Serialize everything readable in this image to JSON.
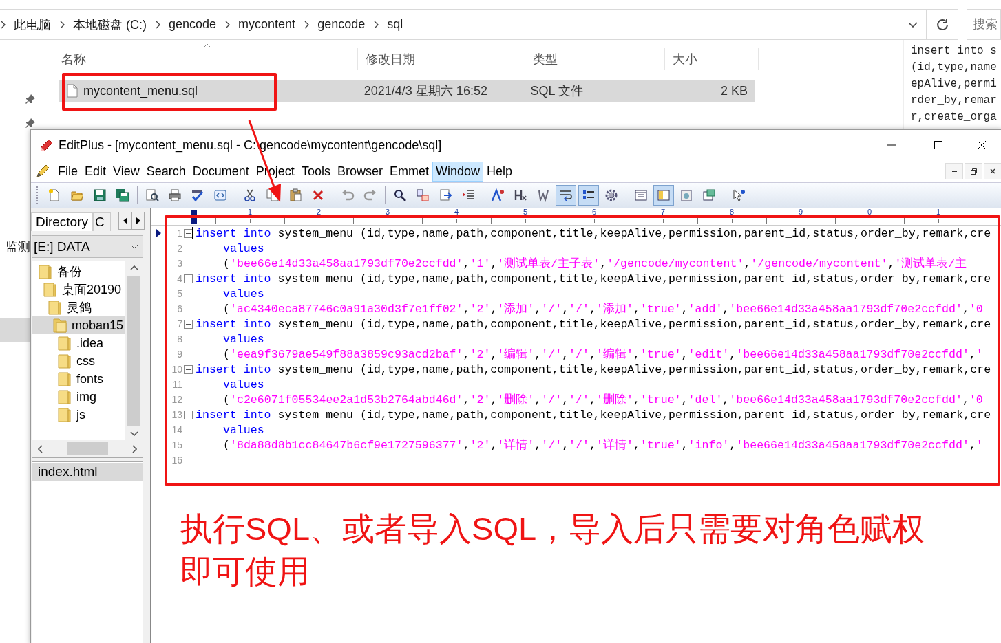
{
  "explorer": {
    "breadcrumb": [
      "此电脑",
      "本地磁盘 (C:)",
      "gencode",
      "mycontent",
      "gencode",
      "sql"
    ],
    "search": {
      "placeholder": "搜索"
    },
    "columns": [
      "名称",
      "修改日期",
      "类型",
      "大小"
    ],
    "files": [
      {
        "name": "mycontent_menu.sql",
        "modified": "2021/4/3 星期六 16:52",
        "type": "SQL 文件",
        "size": "2 KB",
        "selected": true
      }
    ],
    "preview_lines": [
      "insert into s",
      "(id,type,name",
      "epAlive,permi",
      "rder_by,remar",
      "r,create_orga"
    ],
    "nav_label": "监测"
  },
  "editplus": {
    "title": "EditPlus - [mycontent_menu.sql - C:\\gencode\\mycontent\\gencode\\sql]",
    "menu": [
      {
        "label": "File",
        "selected": false
      },
      {
        "label": "Edit",
        "selected": false
      },
      {
        "label": "View",
        "selected": false
      },
      {
        "label": "Search",
        "selected": false
      },
      {
        "label": "Document",
        "selected": false
      },
      {
        "label": "Project",
        "selected": false
      },
      {
        "label": "Tools",
        "selected": false
      },
      {
        "label": "Browser",
        "selected": false
      },
      {
        "label": "Emmet",
        "selected": false
      },
      {
        "label": "Window",
        "selected": true
      },
      {
        "label": "Help",
        "selected": false
      }
    ],
    "toolbar": [
      {
        "buttons": [
          {
            "kind": "new",
            "pressed": false
          },
          {
            "kind": "open",
            "pressed": false
          },
          {
            "kind": "save",
            "pressed": false
          },
          {
            "kind": "saveall",
            "pressed": false
          }
        ]
      },
      {
        "buttons": [
          {
            "kind": "preview",
            "pressed": false
          },
          {
            "kind": "print",
            "pressed": false
          },
          {
            "kind": "spell",
            "pressed": false
          },
          {
            "kind": "browser",
            "pressed": false
          }
        ]
      },
      {
        "buttons": [
          {
            "kind": "cut",
            "pressed": false
          },
          {
            "kind": "copy",
            "pressed": false
          },
          {
            "kind": "paste",
            "pressed": false
          },
          {
            "kind": "delete",
            "pressed": false
          }
        ]
      },
      {
        "buttons": [
          {
            "kind": "undo",
            "pressed": false
          },
          {
            "kind": "redo",
            "pressed": false
          }
        ]
      },
      {
        "buttons": [
          {
            "kind": "find",
            "pressed": false
          },
          {
            "kind": "replace",
            "pressed": false
          },
          {
            "kind": "goto",
            "pressed": false
          },
          {
            "kind": "indent",
            "pressed": false
          }
        ]
      },
      {
        "buttons": [
          {
            "kind": "font",
            "pressed": false
          },
          {
            "kind": "heading",
            "pressed": false
          },
          {
            "kind": "italic",
            "pressed": false
          },
          {
            "kind": "wrap",
            "pressed": true
          },
          {
            "kind": "linenum",
            "pressed": true
          },
          {
            "kind": "settings",
            "pressed": false
          }
        ]
      },
      {
        "buttons": [
          {
            "kind": "panel",
            "pressed": false
          },
          {
            "kind": "sidebar",
            "pressed": true
          },
          {
            "kind": "clip",
            "pressed": false
          },
          {
            "kind": "window",
            "pressed": false
          }
        ]
      },
      {
        "buttons": [
          {
            "kind": "help",
            "pressed": false
          }
        ]
      }
    ],
    "sidebar": {
      "tabs": [
        {
          "label": "Directory",
          "selected": true
        },
        {
          "label": "C",
          "selected": false
        }
      ],
      "drive": "[E:] DATA",
      "tree": [
        {
          "label": "备份",
          "selected": false,
          "children": [
            {
              "label": "桌面20190",
              "selected": false,
              "children": [
                {
                  "label": "灵鸽",
                  "selected": false,
                  "children": [
                    {
                      "label": "moban15",
                      "selected": true,
                      "children": [
                        {
                          "label": ".idea",
                          "selected": false
                        },
                        {
                          "label": "css",
                          "selected": false
                        },
                        {
                          "label": "fonts",
                          "selected": false
                        },
                        {
                          "label": "img",
                          "selected": false
                        },
                        {
                          "label": "js",
                          "selected": false
                        }
                      ]
                    }
                  ]
                }
              ]
            }
          ]
        }
      ],
      "files": [
        {
          "label": "index.html",
          "selected": true
        }
      ]
    },
    "ruler": [
      "1",
      "2",
      "3",
      "4",
      "5",
      "6",
      "7",
      "8",
      "9",
      "0",
      "1"
    ],
    "lines": [
      {
        "number": "1",
        "current": true,
        "foldable": true,
        "indented": false,
        "tokens": [
          {
            "kind": "keyword",
            "text": "insert into"
          },
          {
            "kind": "plain",
            "text": " system_menu (id,type,name,path,component,title,keepAlive,permission,parent_id,status,order_by,remark,cre"
          }
        ]
      },
      {
        "number": "2",
        "current": false,
        "foldable": false,
        "indented": true,
        "tokens": [
          {
            "kind": "keyword",
            "text": "values"
          }
        ]
      },
      {
        "number": "3",
        "current": false,
        "foldable": false,
        "indented": true,
        "tokens": [
          {
            "kind": "plain",
            "text": "("
          },
          {
            "kind": "string",
            "text": "'bee66e14d33a458aa1793df70e2ccfdd'"
          },
          {
            "kind": "plain",
            "text": ","
          },
          {
            "kind": "string",
            "text": "'1'"
          },
          {
            "kind": "plain",
            "text": ","
          },
          {
            "kind": "string",
            "text": "'测试单表/主子表'"
          },
          {
            "kind": "plain",
            "text": ","
          },
          {
            "kind": "string",
            "text": "'/gencode/mycontent'"
          },
          {
            "kind": "plain",
            "text": ","
          },
          {
            "kind": "string",
            "text": "'/gencode/mycontent'"
          },
          {
            "kind": "plain",
            "text": ","
          },
          {
            "kind": "string",
            "text": "'测试单表/主"
          }
        ]
      },
      {
        "number": "4",
        "current": false,
        "foldable": true,
        "indented": false,
        "tokens": [
          {
            "kind": "keyword",
            "text": "insert into"
          },
          {
            "kind": "plain",
            "text": " system_menu (id,type,name,path,component,title,keepAlive,permission,parent_id,status,order_by,remark,cre"
          }
        ]
      },
      {
        "number": "5",
        "current": false,
        "foldable": false,
        "indented": true,
        "tokens": [
          {
            "kind": "keyword",
            "text": "values"
          }
        ]
      },
      {
        "number": "6",
        "current": false,
        "foldable": false,
        "indented": true,
        "tokens": [
          {
            "kind": "plain",
            "text": "("
          },
          {
            "kind": "string",
            "text": "'ac4340eca87746c0a91a30d3f7e1ff02'"
          },
          {
            "kind": "plain",
            "text": ","
          },
          {
            "kind": "string",
            "text": "'2'"
          },
          {
            "kind": "plain",
            "text": ","
          },
          {
            "kind": "string",
            "text": "'添加'"
          },
          {
            "kind": "plain",
            "text": ","
          },
          {
            "kind": "string",
            "text": "'/'"
          },
          {
            "kind": "plain",
            "text": ","
          },
          {
            "kind": "string",
            "text": "'/'"
          },
          {
            "kind": "plain",
            "text": ","
          },
          {
            "kind": "string",
            "text": "'添加'"
          },
          {
            "kind": "plain",
            "text": ","
          },
          {
            "kind": "string",
            "text": "'true'"
          },
          {
            "kind": "plain",
            "text": ","
          },
          {
            "kind": "string",
            "text": "'add'"
          },
          {
            "kind": "plain",
            "text": ","
          },
          {
            "kind": "string",
            "text": "'bee66e14d33a458aa1793df70e2ccfdd'"
          },
          {
            "kind": "plain",
            "text": ","
          },
          {
            "kind": "string",
            "text": "'0"
          }
        ]
      },
      {
        "number": "7",
        "current": false,
        "foldable": true,
        "indented": false,
        "tokens": [
          {
            "kind": "keyword",
            "text": "insert into"
          },
          {
            "kind": "plain",
            "text": " system_menu (id,type,name,path,component,title,keepAlive,permission,parent_id,status,order_by,remark,cre"
          }
        ]
      },
      {
        "number": "8",
        "current": false,
        "foldable": false,
        "indented": true,
        "tokens": [
          {
            "kind": "keyword",
            "text": "values"
          }
        ]
      },
      {
        "number": "9",
        "current": false,
        "foldable": false,
        "indented": true,
        "tokens": [
          {
            "kind": "plain",
            "text": "("
          },
          {
            "kind": "string",
            "text": "'eea9f3679ae549f88a3859c93acd2baf'"
          },
          {
            "kind": "plain",
            "text": ","
          },
          {
            "kind": "string",
            "text": "'2'"
          },
          {
            "kind": "plain",
            "text": ","
          },
          {
            "kind": "string",
            "text": "'编辑'"
          },
          {
            "kind": "plain",
            "text": ","
          },
          {
            "kind": "string",
            "text": "'/'"
          },
          {
            "kind": "plain",
            "text": ","
          },
          {
            "kind": "string",
            "text": "'/'"
          },
          {
            "kind": "plain",
            "text": ","
          },
          {
            "kind": "string",
            "text": "'编辑'"
          },
          {
            "kind": "plain",
            "text": ","
          },
          {
            "kind": "string",
            "text": "'true'"
          },
          {
            "kind": "plain",
            "text": ","
          },
          {
            "kind": "string",
            "text": "'edit'"
          },
          {
            "kind": "plain",
            "text": ","
          },
          {
            "kind": "string",
            "text": "'bee66e14d33a458aa1793df70e2ccfdd'"
          },
          {
            "kind": "plain",
            "text": ","
          },
          {
            "kind": "string",
            "text": "'"
          }
        ]
      },
      {
        "number": "10",
        "current": false,
        "foldable": true,
        "indented": false,
        "tokens": [
          {
            "kind": "keyword",
            "text": "insert into"
          },
          {
            "kind": "plain",
            "text": " system_menu (id,type,name,path,component,title,keepAlive,permission,parent_id,status,order_by,remark,cre"
          }
        ]
      },
      {
        "number": "11",
        "current": false,
        "foldable": false,
        "indented": true,
        "tokens": [
          {
            "kind": "keyword",
            "text": "values"
          }
        ]
      },
      {
        "number": "12",
        "current": false,
        "foldable": false,
        "indented": true,
        "tokens": [
          {
            "kind": "plain",
            "text": "("
          },
          {
            "kind": "string",
            "text": "'c2e6071f05534ee2a1d53b2764abd46d'"
          },
          {
            "kind": "plain",
            "text": ","
          },
          {
            "kind": "string",
            "text": "'2'"
          },
          {
            "kind": "plain",
            "text": ","
          },
          {
            "kind": "string",
            "text": "'删除'"
          },
          {
            "kind": "plain",
            "text": ","
          },
          {
            "kind": "string",
            "text": "'/'"
          },
          {
            "kind": "plain",
            "text": ","
          },
          {
            "kind": "string",
            "text": "'/'"
          },
          {
            "kind": "plain",
            "text": ","
          },
          {
            "kind": "string",
            "text": "'删除'"
          },
          {
            "kind": "plain",
            "text": ","
          },
          {
            "kind": "string",
            "text": "'true'"
          },
          {
            "kind": "plain",
            "text": ","
          },
          {
            "kind": "string",
            "text": "'del'"
          },
          {
            "kind": "plain",
            "text": ","
          },
          {
            "kind": "string",
            "text": "'bee66e14d33a458aa1793df70e2ccfdd'"
          },
          {
            "kind": "plain",
            "text": ","
          },
          {
            "kind": "string",
            "text": "'0"
          }
        ]
      },
      {
        "number": "13",
        "current": false,
        "foldable": true,
        "indented": false,
        "tokens": [
          {
            "kind": "keyword",
            "text": "insert into"
          },
          {
            "kind": "plain",
            "text": " system_menu (id,type,name,path,component,title,keepAlive,permission,parent_id,status,order_by,remark,cre"
          }
        ]
      },
      {
        "number": "14",
        "current": false,
        "foldable": false,
        "indented": true,
        "tokens": [
          {
            "kind": "keyword",
            "text": "values"
          }
        ]
      },
      {
        "number": "15",
        "current": false,
        "foldable": false,
        "indented": true,
        "tokens": [
          {
            "kind": "plain",
            "text": "("
          },
          {
            "kind": "string",
            "text": "'8da88d8b1cc84647b6cf9e1727596377'"
          },
          {
            "kind": "plain",
            "text": ","
          },
          {
            "kind": "string",
            "text": "'2'"
          },
          {
            "kind": "plain",
            "text": ","
          },
          {
            "kind": "string",
            "text": "'详情'"
          },
          {
            "kind": "plain",
            "text": ","
          },
          {
            "kind": "string",
            "text": "'/'"
          },
          {
            "kind": "plain",
            "text": ","
          },
          {
            "kind": "string",
            "text": "'/'"
          },
          {
            "kind": "plain",
            "text": ","
          },
          {
            "kind": "string",
            "text": "'详情'"
          },
          {
            "kind": "plain",
            "text": ","
          },
          {
            "kind": "string",
            "text": "'true'"
          },
          {
            "kind": "plain",
            "text": ","
          },
          {
            "kind": "string",
            "text": "'info'"
          },
          {
            "kind": "plain",
            "text": ","
          },
          {
            "kind": "string",
            "text": "'bee66e14d33a458aa1793df70e2ccfdd'"
          },
          {
            "kind": "plain",
            "text": ","
          },
          {
            "kind": "string",
            "text": "'"
          }
        ]
      },
      {
        "number": "16",
        "current": false,
        "foldable": false
      }
    ]
  },
  "annotation": {
    "caption": "执行SQL、或者导入SQL，导入后只需要对角色赋权即可使用"
  }
}
